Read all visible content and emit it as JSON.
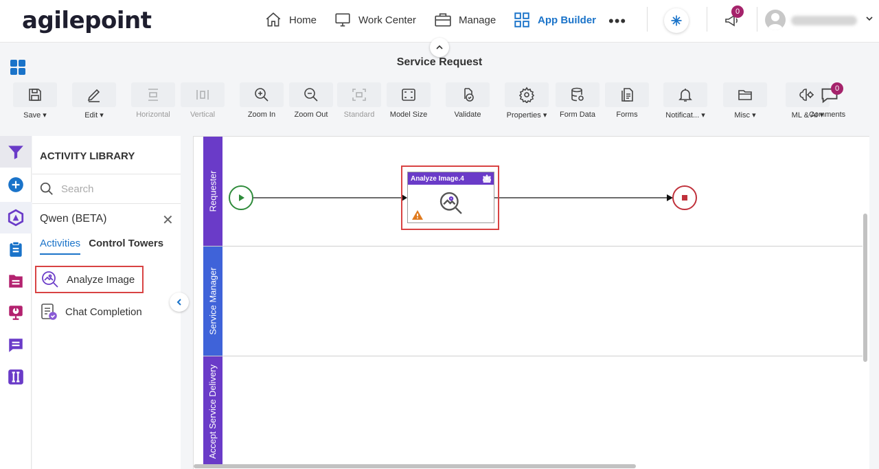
{
  "header": {
    "logo": "agilepoint",
    "nav": [
      {
        "label": "Home",
        "icon": "home-icon"
      },
      {
        "label": "Work Center",
        "icon": "monitor-icon"
      },
      {
        "label": "Manage",
        "icon": "briefcase-icon"
      },
      {
        "label": "App Builder",
        "icon": "grid-icon",
        "active": true
      }
    ],
    "more": "•••",
    "notifications_count": "0",
    "comments_count": "0"
  },
  "page": {
    "title": "Service Request"
  },
  "toolbar": {
    "save": "Save",
    "edit": "Edit",
    "horizontal": "Horizontal",
    "vertical": "Vertical",
    "zoom_in": "Zoom In",
    "zoom_out": "Zoom Out",
    "standard": "Standard",
    "model_size": "Model Size",
    "validate": "Validate",
    "properties": "Properties",
    "form_data": "Form Data",
    "forms": "Forms",
    "notifications": "Notificat...",
    "misc": "Misc",
    "ml_ai": "ML & AI",
    "comments": "Comments"
  },
  "library": {
    "title": "ACTIVITY LIBRARY",
    "search_placeholder": "Search",
    "category": "Qwen (BETA)",
    "tabs": [
      "Activities",
      "Control Towers"
    ],
    "items": [
      "Analyze Image",
      "Chat Completion"
    ]
  },
  "canvas": {
    "lanes": [
      "Requester",
      "Service Manager",
      "Accept Service Delivery"
    ],
    "task_title": "Analyze Image.4"
  },
  "colors": {
    "accent": "#1a73c9",
    "lane_requester": "#6a3bc8",
    "lane_service_manager": "#3f63d9",
    "badge": "#a5236b",
    "highlight": "#d84242"
  }
}
